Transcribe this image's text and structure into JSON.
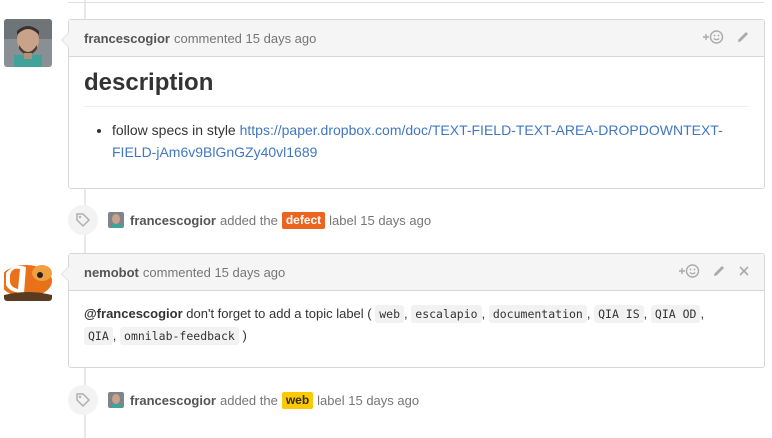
{
  "comment1": {
    "author": "francescogior",
    "action": "commented",
    "time": "15 days ago",
    "heading": "description",
    "bullet_text": "follow specs in style",
    "link_line1": "https://paper.dropbox.com/doc/TEXT-FIELD-TEXT-AREA-DROPDOWNTEXT-",
    "link_line2": "FIELD-jAm6v9BlGnGZy40vl1689"
  },
  "event1": {
    "author": "francescogior",
    "pre": "added the",
    "label": "defect",
    "post": "label 15 days ago",
    "label_color": "#eb6420"
  },
  "comment2": {
    "author": "nemobot",
    "action": "commented",
    "time": "15 days ago",
    "mention": "@francescogior",
    "text": "don't forget to add a topic label (",
    "labels": [
      "web",
      "escalapio",
      "documentation",
      "QIA IS",
      "QIA OD",
      "QIA",
      "omnilab-feedback"
    ],
    "sep": ",",
    "close": ")"
  },
  "event2": {
    "author": "francescogior",
    "pre": "added the",
    "label": "web",
    "post": "label 15 days ago",
    "label_color": "#fbca04"
  },
  "icons": {
    "reaction": "smiley-plus-icon",
    "edit": "pencil-icon",
    "close": "close-icon",
    "tag": "tag-icon"
  }
}
